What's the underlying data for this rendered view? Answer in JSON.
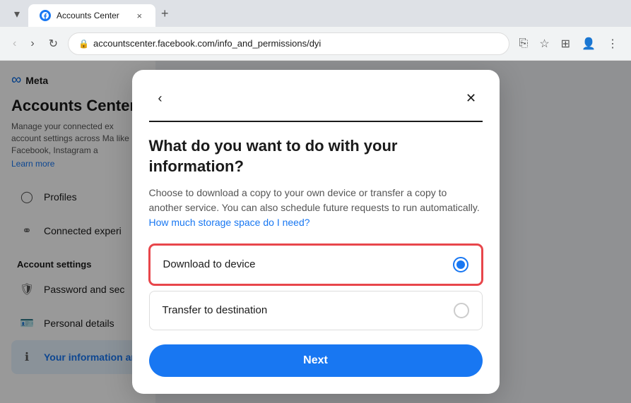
{
  "browser": {
    "tab_title": "Accounts Center",
    "favicon_label": "Facebook favicon",
    "tab_close_label": "×",
    "new_tab_label": "+",
    "nav_back_label": "‹",
    "nav_forward_label": "›",
    "nav_refresh_label": "↻",
    "url_text": "accountscenter.facebook.com/info_and_permissions/dyi",
    "url_full_display": "accountscenter.facebook.com/info_and_permissions/dyi",
    "screen_cast_icon": "⎘",
    "bookmark_icon": "☆",
    "extensions_icon": "⊞",
    "profile_icon": "👤",
    "menu_icon": "⋮",
    "tab_dropdown_icon": "▾"
  },
  "sidebar": {
    "meta_logo": "∞",
    "meta_label": "Meta",
    "title": "Accounts Center",
    "description": "Manage your connected ex account settings across Ma like Facebook, Instagram a",
    "learn_more": "Learn more",
    "nav_items": [
      {
        "icon": "person",
        "label": "Profiles"
      },
      {
        "icon": "link",
        "label": "Connected experi"
      }
    ],
    "section_title": "Account settings",
    "settings_items": [
      {
        "icon": "shield",
        "label": "Password and sec"
      },
      {
        "icon": "id-card",
        "label": "Personal details"
      },
      {
        "icon": "info",
        "label": "Your information an"
      }
    ]
  },
  "modal": {
    "back_label": "‹",
    "close_label": "✕",
    "title": "What do you want to do with your information?",
    "description": "Choose to download a copy to your own device or transfer a copy to another service. You can also schedule future requests to run automatically.",
    "link_text": "How much storage space do I need?",
    "options": [
      {
        "label": "Download to device",
        "selected": true
      },
      {
        "label": "Transfer to destination",
        "selected": false
      }
    ],
    "next_button": "Next"
  }
}
